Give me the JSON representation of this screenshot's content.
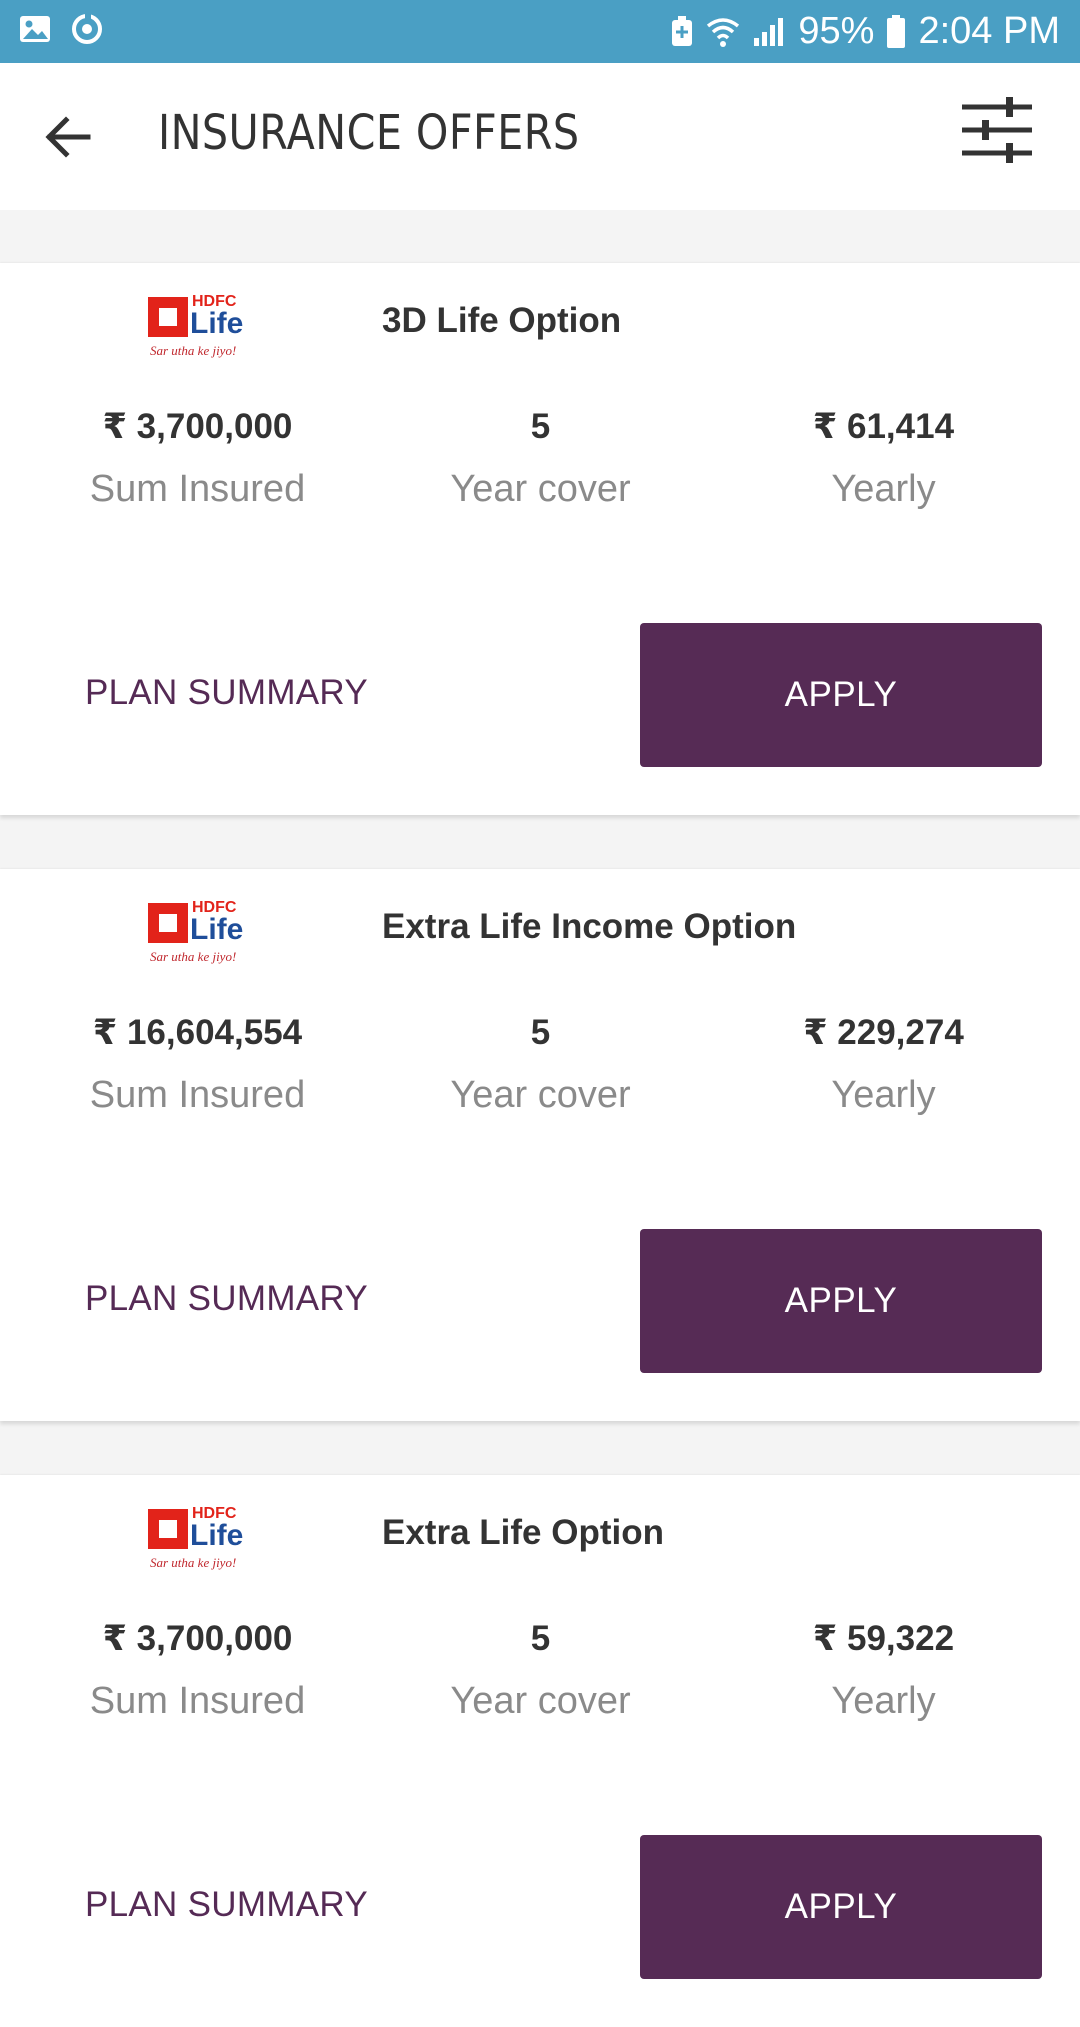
{
  "status_bar": {
    "battery_percent": "95%",
    "time": "2:04 PM",
    "icons": [
      "image-icon",
      "sync-icon",
      "battery-saver-icon",
      "wifi-icon",
      "signal-icon",
      "battery-icon"
    ]
  },
  "app_bar": {
    "title": "INSURANCE OFFERS",
    "back_icon": "arrow-left-icon",
    "filter_icon": "sliders-icon"
  },
  "logo": {
    "brand_top": "HDFC",
    "brand_main": "Life",
    "tagline": "Sar utha ke jiyo!"
  },
  "colors": {
    "status_bar": "#4a9fc4",
    "accent": "#562b55",
    "logo_red": "#e2231a",
    "logo_blue": "#1f4e9a"
  },
  "offers": [
    {
      "plan_name": "3D Life Option",
      "sum_insured": "₹ 3,700,000",
      "sum_insured_label": "Sum Insured",
      "years": "5",
      "years_label": "Year cover",
      "premium": "₹ 61,414",
      "premium_label": "Yearly",
      "summary_label": "PLAN SUMMARY",
      "apply_label": "APPLY"
    },
    {
      "plan_name": "Extra Life Income Option",
      "sum_insured": "₹ 16,604,554",
      "sum_insured_label": "Sum Insured",
      "years": "5",
      "years_label": "Year cover",
      "premium": "₹ 229,274",
      "premium_label": "Yearly",
      "summary_label": "PLAN SUMMARY",
      "apply_label": "APPLY"
    },
    {
      "plan_name": "Extra Life Option",
      "sum_insured": "₹ 3,700,000",
      "sum_insured_label": "Sum Insured",
      "years": "5",
      "years_label": "Year cover",
      "premium": "₹ 59,322",
      "premium_label": "Yearly",
      "summary_label": "PLAN SUMMARY",
      "apply_label": "APPLY"
    }
  ]
}
